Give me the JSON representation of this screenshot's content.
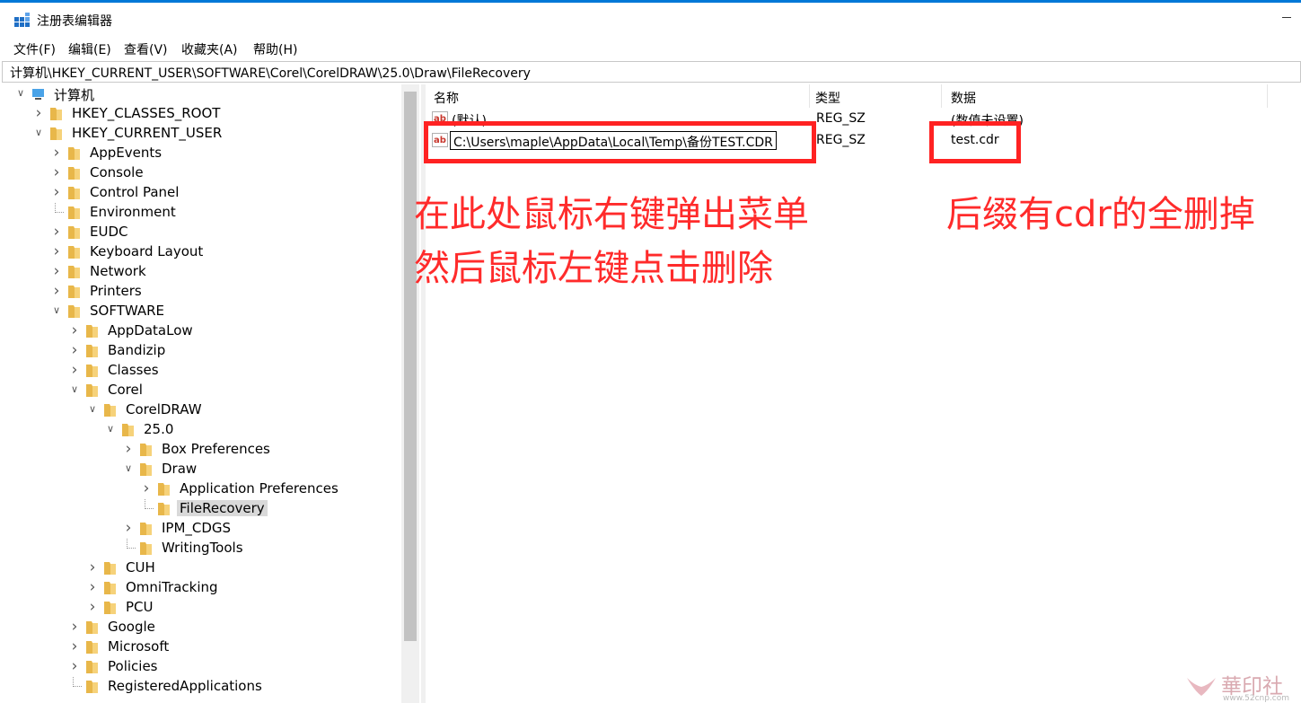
{
  "window": {
    "title": "注册表编辑器",
    "icon": "regedit-icon"
  },
  "menu": [
    "文件(F)",
    "编辑(E)",
    "查看(V)",
    "收藏夹(A)",
    "帮助(H)"
  ],
  "address": "计算机\\HKEY_CURRENT_USER\\SOFTWARE\\Corel\\CorelDRAW\\25.0\\Draw\\FileRecovery",
  "tree": [
    {
      "label": "计算机",
      "icon": "computer-icon",
      "expand": "open"
    },
    {
      "label": "HKEY_CLASSES_ROOT",
      "expand": "closed"
    },
    {
      "label": "HKEY_CURRENT_USER",
      "expand": "open"
    },
    {
      "label": "AppEvents",
      "expand": "closed"
    },
    {
      "label": "Console",
      "expand": "closed"
    },
    {
      "label": "Control Panel",
      "expand": "closed"
    },
    {
      "label": "Environment",
      "expand": "none"
    },
    {
      "label": "EUDC",
      "expand": "closed"
    },
    {
      "label": "Keyboard Layout",
      "expand": "closed"
    },
    {
      "label": "Network",
      "expand": "closed"
    },
    {
      "label": "Printers",
      "expand": "closed"
    },
    {
      "label": "SOFTWARE",
      "expand": "open"
    },
    {
      "label": "AppDataLow",
      "expand": "closed"
    },
    {
      "label": "Bandizip",
      "expand": "closed"
    },
    {
      "label": "Classes",
      "expand": "closed"
    },
    {
      "label": "Corel",
      "expand": "open"
    },
    {
      "label": "CorelDRAW",
      "expand": "open"
    },
    {
      "label": "25.0",
      "expand": "open"
    },
    {
      "label": "Box Preferences",
      "expand": "closed"
    },
    {
      "label": "Draw",
      "expand": "open"
    },
    {
      "label": "Application Preferences",
      "expand": "closed"
    },
    {
      "label": "FileRecovery",
      "expand": "none",
      "selected": true
    },
    {
      "label": "IPM_CDGS",
      "expand": "closed"
    },
    {
      "label": "WritingTools",
      "expand": "none"
    },
    {
      "label": "CUH",
      "expand": "closed"
    },
    {
      "label": "OmniTracking",
      "expand": "closed"
    },
    {
      "label": "PCU",
      "expand": "closed"
    },
    {
      "label": "Google",
      "expand": "closed"
    },
    {
      "label": "Microsoft",
      "expand": "closed"
    },
    {
      "label": "Policies",
      "expand": "closed"
    },
    {
      "label": "RegisteredApplications",
      "expand": "none"
    }
  ],
  "columns": {
    "name": "名称",
    "type": "类型",
    "data": "数据"
  },
  "values": [
    {
      "name": "(默认)",
      "type": "REG_SZ",
      "data": "(数值未设置)",
      "icon": "string-value-icon"
    },
    {
      "name": "C:\\Users\\maple\\AppData\\Local\\Temp\\备份TEST.CDR",
      "type": "REG_SZ",
      "data": "test.cdr",
      "icon": "string-value-icon",
      "editing": true
    }
  ],
  "annotations": {
    "line1": "在此处鼠标右键弹出菜单",
    "line2": "然后鼠标左键点击删除",
    "right": "后缀有cdr的全删掉",
    "color": "#ff2b2b"
  },
  "watermark": {
    "text": "華印社區",
    "url": "www.52cnp.com"
  }
}
